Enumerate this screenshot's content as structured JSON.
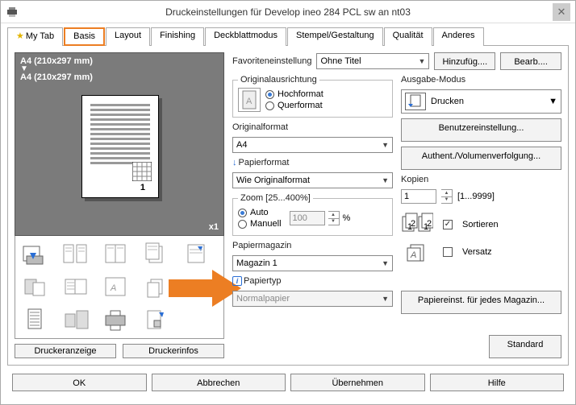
{
  "window": {
    "title": "Druckeinstellungen für Develop ineo 284 PCL sw an nt03"
  },
  "tabs": [
    "My Tab",
    "Basis",
    "Layout",
    "Finishing",
    "Deckblattmodus",
    "Stempel/Gestaltung",
    "Qualität",
    "Anderes"
  ],
  "activeTab": 1,
  "preview": {
    "size1": "A4 (210x297 mm)",
    "size2": "A4 (210x297 mm)",
    "count": "x1",
    "pageNum": "1"
  },
  "leftButtons": {
    "anzeige": "Druckeranzeige",
    "infos": "Druckerinfos"
  },
  "fav": {
    "label": "Favoriteneinstellung",
    "value": "Ohne Titel",
    "addBtn": "Hinzufüg....",
    "editBtn": "Bearb...."
  },
  "orient": {
    "legend": "Originalausrichtung",
    "hoch": "Hochformat",
    "quer": "Querformat"
  },
  "origFormat": {
    "label": "Originalformat",
    "value": "A4"
  },
  "paperFormat": {
    "label": "Papierformat",
    "value": "Wie Originalformat"
  },
  "zoom": {
    "legend": "Zoom [25...400%]",
    "auto": "Auto",
    "manuell": "Manuell",
    "value": "100",
    "pct": "%"
  },
  "magazin": {
    "label": "Papiermagazin",
    "value": "Magazin 1"
  },
  "papiertyp": {
    "label": "Papiertyp",
    "value": "Normalpapier"
  },
  "ausgabe": {
    "label": "Ausgabe-Modus",
    "value": "Drucken"
  },
  "benutzer": "Benutzereinstellung...",
  "authent": "Authent./Volumenverfolgung...",
  "kopien": {
    "label": "Kopien",
    "value": "1",
    "range": "[1...9999]"
  },
  "sortieren": "Sortieren",
  "versatz": "Versatz",
  "paperPerMag": "Papiereinst. für jedes Magazin...",
  "standard": "Standard",
  "footer": {
    "ok": "OK",
    "abbrechen": "Abbrechen",
    "uebernehmen": "Übernehmen",
    "hilfe": "Hilfe"
  }
}
